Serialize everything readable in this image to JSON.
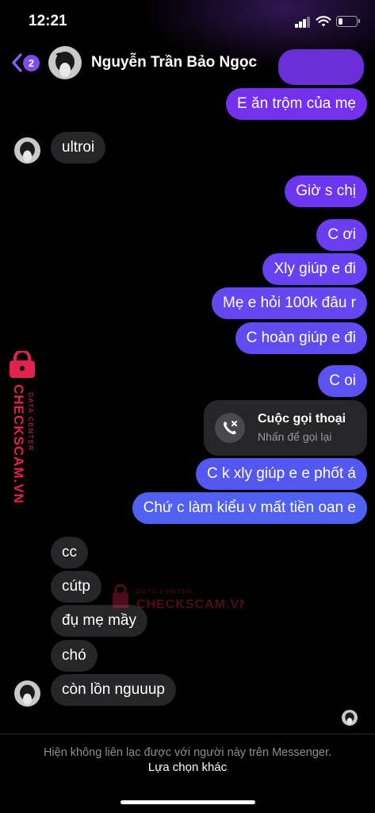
{
  "status_bar": {
    "time": "12:21",
    "battery_level": 0.25
  },
  "header": {
    "unread_count": "2",
    "contact_name": "Nguyễn Trần Bảo Ngọc"
  },
  "messages": [
    {
      "dir": "out",
      "text": "E ăn trộm của mẹ"
    },
    {
      "dir": "in",
      "text": "ultroi"
    },
    {
      "dir": "out",
      "text": "Giờ s chị"
    },
    {
      "dir": "out",
      "text": "C ơi"
    },
    {
      "dir": "out",
      "text": "Xly giúp e đi"
    },
    {
      "dir": "out",
      "text": "Mẹ e hỏi 100k đâu r"
    },
    {
      "dir": "out",
      "text": "C hoàn giúp e đi"
    },
    {
      "dir": "out",
      "text": "C oi"
    },
    {
      "dir": "out",
      "text": "C k xly giúp e e phốt á"
    },
    {
      "dir": "out",
      "text": "Chứ c làm kiểu v mất tiền oan e"
    },
    {
      "dir": "in",
      "text": "cc"
    },
    {
      "dir": "in",
      "text": "cútp"
    },
    {
      "dir": "in",
      "text": "đụ mẹ mầy"
    },
    {
      "dir": "in",
      "text": "chó"
    },
    {
      "dir": "in",
      "text": "còn lồn nguuup"
    }
  ],
  "call_card": {
    "title": "Cuộc gọi thoại",
    "subtitle": "Nhấn để gọi lại",
    "icon": "missed-call-icon"
  },
  "watermark": {
    "brand": "CHECKSCAM.VN",
    "tagline": "DATA CENTER",
    "color": "#e0234e"
  },
  "footer": {
    "notice": "Hiện không liên lạc được với người này trên Messenger.",
    "action": "Lựa chọn khác"
  },
  "colors": {
    "accent": "#7b4cf0",
    "incoming_bubble": "#262628"
  }
}
